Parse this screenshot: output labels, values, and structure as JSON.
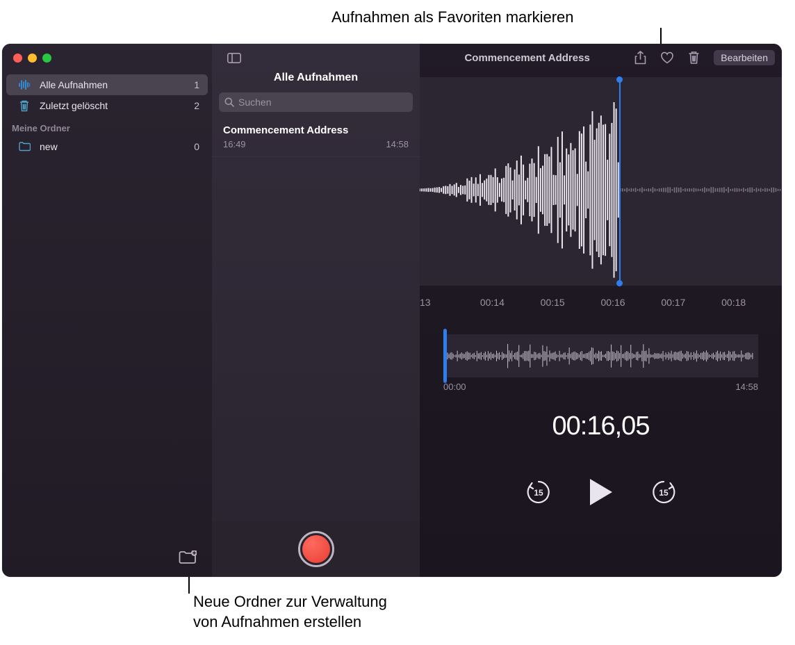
{
  "callouts": {
    "favorite": "Aufnahmen als Favoriten markieren",
    "new_folder_line1": "Neue Ordner zur Verwaltung",
    "new_folder_line2": "von Aufnahmen erstellen"
  },
  "colors": {
    "accent": "#2f7ef0",
    "record": "#e83e32"
  },
  "titlebar": {
    "title": "Commencement Address",
    "edit_label": "Bearbeiten"
  },
  "sidebar": {
    "all": {
      "label": "Alle Aufnahmen",
      "count": "1"
    },
    "deleted": {
      "label": "Zuletzt gelöscht",
      "count": "2"
    },
    "section_header": "Meine Ordner",
    "folder": {
      "label": "new",
      "count": "0"
    }
  },
  "list": {
    "title": "Alle Aufnahmen",
    "search_placeholder": "Suchen",
    "item": {
      "name": "Commencement Address",
      "time": "16:49",
      "duration": "14:58"
    }
  },
  "detail": {
    "ruler": [
      "13",
      "00:14",
      "00:15",
      "00:16",
      "00:17",
      "00:18"
    ],
    "overview": {
      "start": "00:00",
      "end": "14:58"
    },
    "timecode": "00:16,05",
    "skip_amount": "15"
  }
}
